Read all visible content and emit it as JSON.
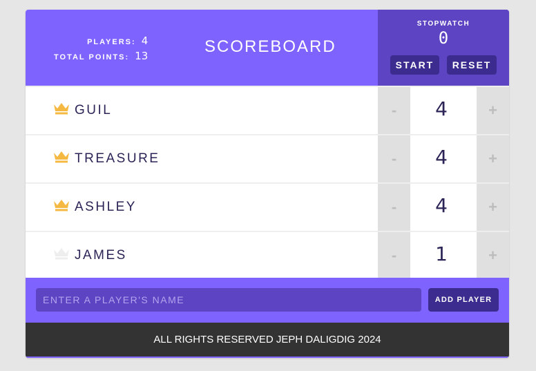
{
  "header": {
    "players_label": "PLAYERS:",
    "players_count": "4",
    "total_points_label": "TOTAL POINTS:",
    "total_points": "13",
    "title": "SCOREBOARD"
  },
  "stopwatch": {
    "label": "STOPWATCH",
    "time": "0",
    "start_label": "START",
    "reset_label": "RESET"
  },
  "players": [
    {
      "name": "GUIL",
      "score": "4",
      "minus": "-",
      "plus": "+",
      "crown": "crown-icon-gold"
    },
    {
      "name": "TREASURE",
      "score": "4",
      "minus": "-",
      "plus": "+",
      "crown": "crown-icon-gold"
    },
    {
      "name": "ASHLEY",
      "score": "4",
      "minus": "-",
      "plus": "+",
      "crown": "crown-icon-gold"
    },
    {
      "name": "JAMES",
      "score": "1",
      "minus": "-",
      "plus": "+",
      "crown": "crown-icon-faded"
    }
  ],
  "add_player": {
    "placeholder": "ENTER A PLAYER'S NAME",
    "button_label": "ADD PLAYER"
  },
  "footer": {
    "text": "ALL RIGHTS RESERVED JEPH DALIGDIG 2024"
  },
  "colors": {
    "accent": "#7f63ff",
    "accent_dark": "#5c44c2",
    "button_dark": "#3d2c8f",
    "crown_gold": "#f5b942",
    "crown_faded": "#eeeeee"
  }
}
